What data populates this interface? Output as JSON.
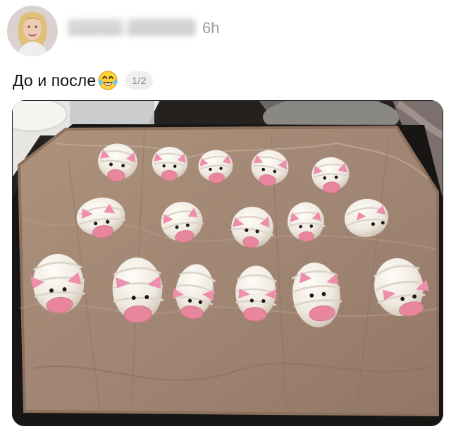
{
  "post": {
    "username": "_____._____",
    "time": "6h",
    "caption": "До и после",
    "caption_emoji": "face-with-tears-of-joy-icon",
    "page_indicator": "1/2"
  },
  "colors": {
    "background": "#ffffff",
    "timestamp": "#9b9b9b",
    "caption": "#111111",
    "badge": "#eeeeef",
    "parchment": "#a58a76",
    "dough": "#f1ede6",
    "pink": "#e98ca6"
  }
}
